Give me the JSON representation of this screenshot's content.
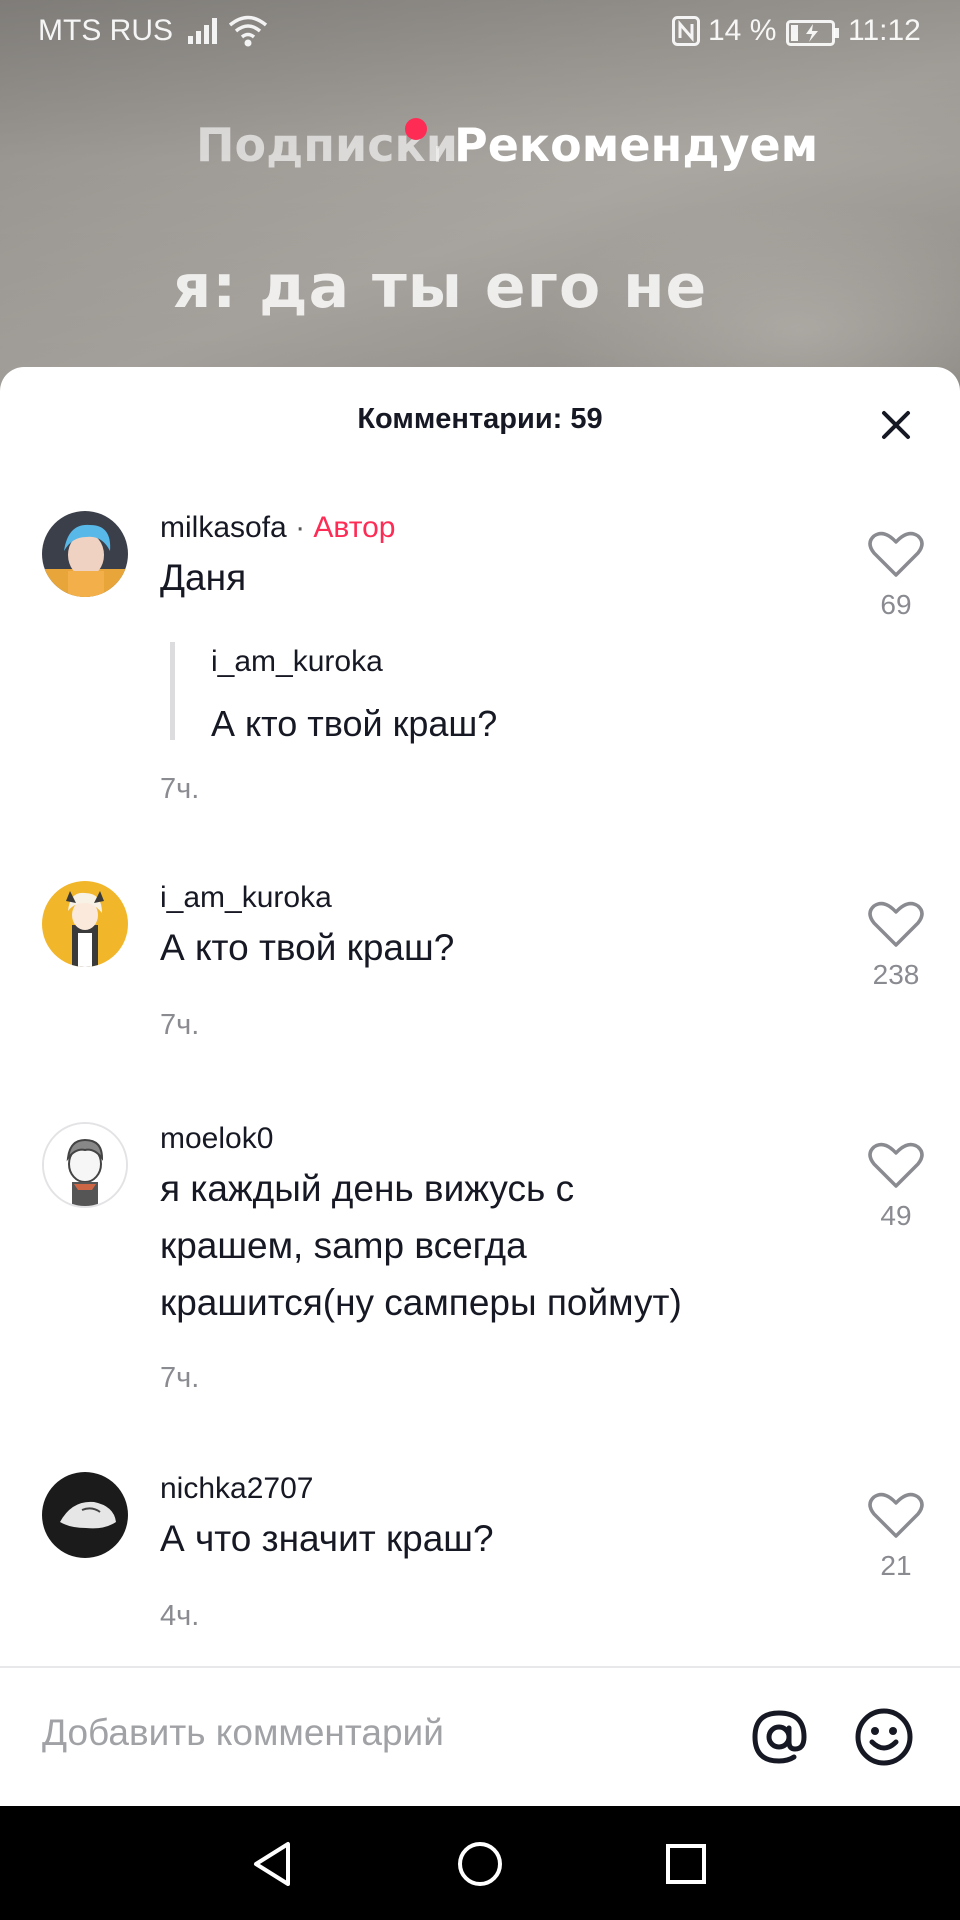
{
  "status_bar": {
    "carrier": "MTS RUS",
    "battery_percent": "14 %",
    "time": "11:12",
    "icons": [
      "signal-icon",
      "wifi-icon",
      "nfc-icon",
      "battery-charging-icon"
    ]
  },
  "feed_tabs": {
    "following": "Подписки",
    "for_you": "Рекомендуем"
  },
  "video": {
    "caption_line1": "я: да ты его не"
  },
  "comments_sheet": {
    "title": "Комментарии: 59",
    "close_icon": "close-icon",
    "comments": [
      {
        "username": "milkasofa",
        "separator": "·",
        "badge": "Автор",
        "text": "Даня",
        "reply_to": {
          "username": "i_am_kuroka",
          "text": "А кто твой краш?"
        },
        "time": "7ч.",
        "likes": "69"
      },
      {
        "username": "i_am_kuroka",
        "text": "А кто твой краш?",
        "time": "7ч.",
        "likes": "238"
      },
      {
        "username": "moelok0",
        "text_lines": [
          "я каждый день вижусь с",
          "крашем, samp всегда",
          "крашится(ну самперы поймут)"
        ],
        "time": "7ч.",
        "likes": "49"
      },
      {
        "username": "nichka2707",
        "text": "А что значит краш?",
        "time": "4ч.",
        "likes": "21"
      }
    ]
  },
  "input_bar": {
    "placeholder": "Добавить комментарий",
    "mention_icon": "at-sign-icon",
    "emoji_icon": "emoji-icon"
  },
  "nav_bar": {
    "icons": [
      "back-triangle-icon",
      "home-circle-icon",
      "recents-square-icon"
    ]
  },
  "colors": {
    "accent": "#fe2c55",
    "text_primary": "#161823",
    "text_secondary": "#8a8b91"
  }
}
